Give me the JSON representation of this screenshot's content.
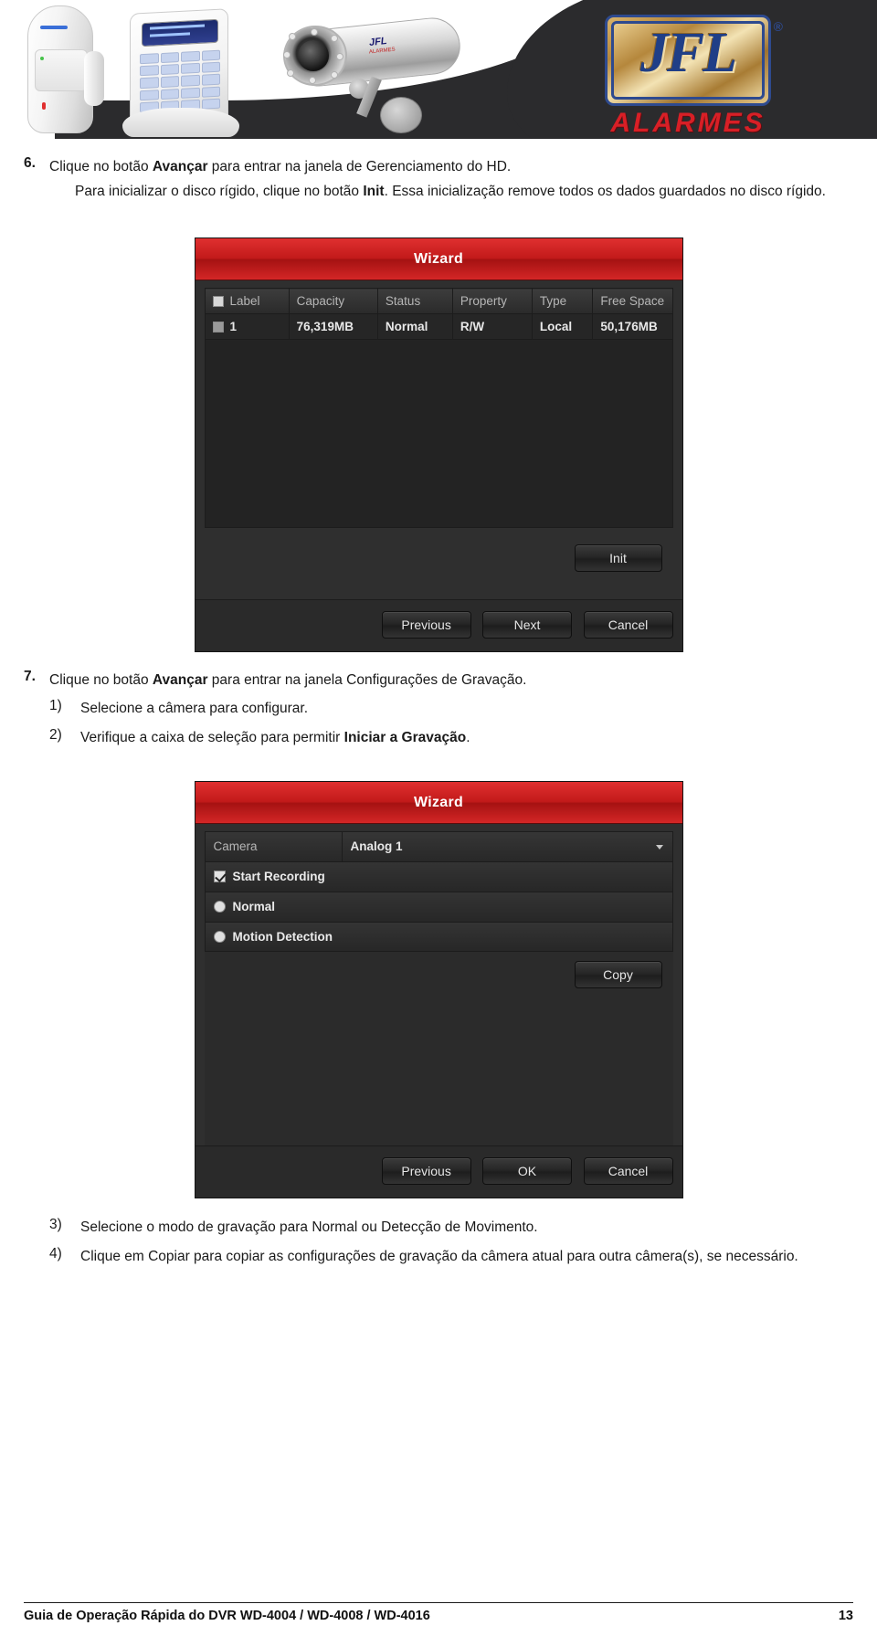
{
  "banner": {
    "logo_text": "JFL",
    "logo_registered": "®",
    "logo_tagline": "ALARMES",
    "product_1": "pir-motion-sensor",
    "product_2": "alarm-keypad",
    "product_3": "bullet-camera"
  },
  "step6": {
    "number": "6.",
    "line1_pre": "Clique no botão ",
    "line1_bold": "Avançar",
    "line1_post": " para entrar na janela de Gerenciamento do HD.",
    "line2_pre": "Para inicializar o disco rígido, clique no botão ",
    "line2_bold": "Init",
    "line2_post": ". Essa inicialização remove todos os dados guardados no disco rígido."
  },
  "dialog_hdd": {
    "title": "Wizard",
    "columns": [
      "Label",
      "Capacity",
      "Status",
      "Property",
      "Type",
      "Free Space"
    ],
    "rows": [
      {
        "label": "1",
        "capacity": "76,319MB",
        "status": "Normal",
        "property": "R/W",
        "type": "Local",
        "free_space": "50,176MB"
      }
    ],
    "init_button": "Init",
    "footer_buttons": [
      "Previous",
      "Next",
      "Cancel"
    ]
  },
  "step7": {
    "number": "7.",
    "line1_pre": "Clique no botão ",
    "line1_bold": "Avançar",
    "line1_post": " para entrar na janela Configurações de Gravação.",
    "sub": [
      {
        "num": "1)",
        "pre": "Selecione a câmera para configurar.",
        "bold": "",
        "post": ""
      },
      {
        "num": "2)",
        "pre": "Verifique a caixa de seleção para permitir ",
        "bold": "Iniciar a Gravação",
        "post": "."
      }
    ]
  },
  "dialog_record": {
    "title": "Wizard",
    "camera_label": "Camera",
    "camera_value": "Analog 1",
    "start_recording_label": "Start Recording",
    "start_recording_checked": true,
    "options": [
      {
        "label": "Normal",
        "selected": false
      },
      {
        "label": "Motion Detection",
        "selected": false
      }
    ],
    "copy_button": "Copy",
    "footer_buttons": [
      "Previous",
      "OK",
      "Cancel"
    ]
  },
  "step7_after": [
    {
      "num": "3)",
      "text": "Selecione o modo de gravação para Normal ou Detecção de Movimento."
    },
    {
      "num": "4)",
      "text": "Clique em Copiar para copiar as configurações de gravação da câmera atual para outra câmera(s), se necessário."
    }
  ],
  "footer": {
    "left": "Guia de Operação Rápida do DVR WD-4004 / WD-4008 / WD-4016",
    "page": "13"
  },
  "colors": {
    "banner_dark": "#2b2b2d",
    "wizard_title_red": "#c21a1a",
    "logo_blue": "#203f87",
    "logo_gold": "#b5873c",
    "alarmes_red": "#d81f26"
  }
}
